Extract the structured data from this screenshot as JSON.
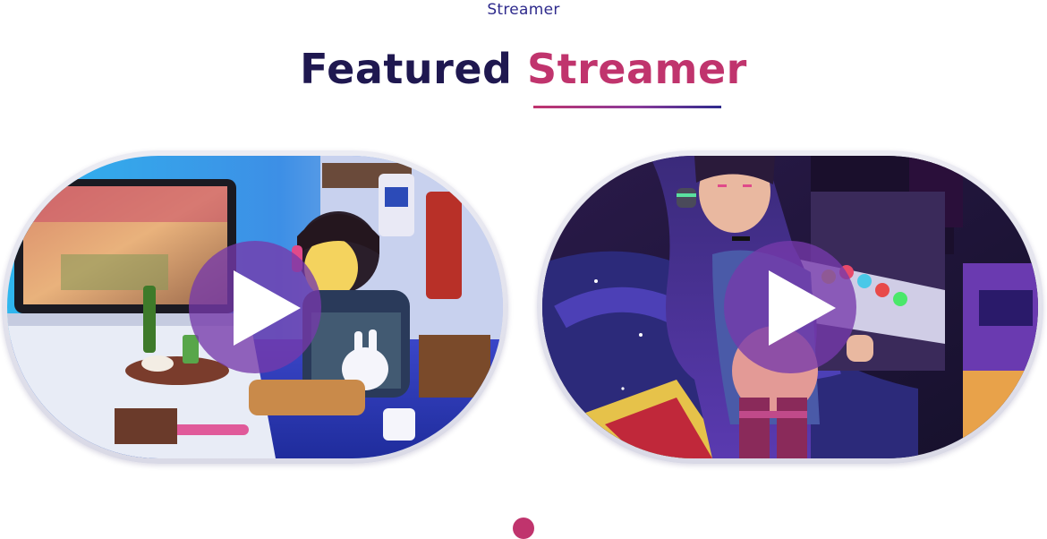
{
  "section": {
    "eyebrow": "Streamer",
    "title_part1": "Featured",
    "title_part2": "Streamer"
  },
  "colors": {
    "title_dark": "#1f1850",
    "title_accent": "#c0346d",
    "eyebrow": "#2e2a8c",
    "play_overlay": "#763aaa",
    "carousel_dot": "#c0346d"
  },
  "videos": [
    {
      "thumbnail": "lego-gamer-room-scene",
      "icon": "play-icon"
    },
    {
      "thumbnail": "arcade-gamer-illustration",
      "icon": "play-icon"
    }
  ],
  "carousel": {
    "dots": 1,
    "active_index": 0
  }
}
